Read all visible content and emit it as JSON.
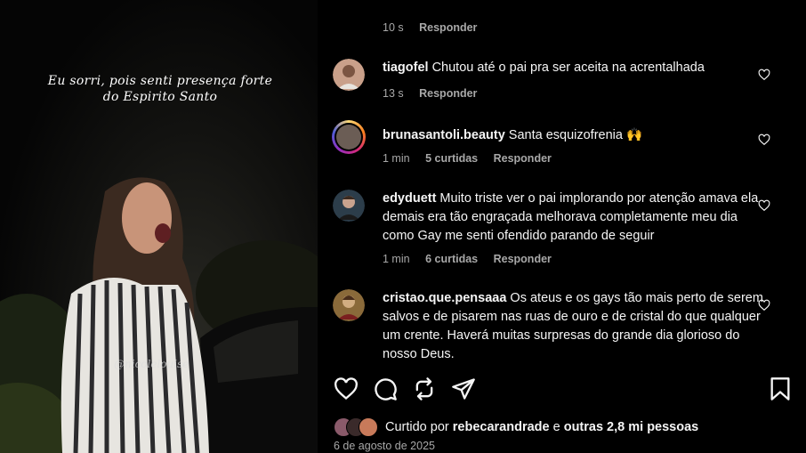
{
  "media": {
    "caption_line1": "Eu sorri, pois senti presença forte",
    "caption_line2": "do Espirito Santo",
    "watermark": "@nicolelouise"
  },
  "top_comment_meta": {
    "time": "10 s",
    "reply": "Responder"
  },
  "comments": [
    {
      "username": "tiagofel",
      "text": "Chutou até o pai pra ser aceita na acrentalhada",
      "time": "13 s",
      "likes": "",
      "reply": "Responder"
    },
    {
      "username": "brunasantoli.beauty",
      "text": "Santa esquizofrenia 🙌",
      "time": "1 min",
      "likes": "5 curtidas",
      "reply": "Responder"
    },
    {
      "username": "edyduett",
      "text": "Muito triste ver o pai implorando por atenção amava ela demais era tão engraçada melhorava completamente meu dia como Gay me senti ofendido parando de seguir",
      "time": "1 min",
      "likes": "6 curtidas",
      "reply": "Responder"
    },
    {
      "username": "cristao.que.pensaaa",
      "text": "Os ateus e os gays tão mais perto de serem salvos e de pisarem nas ruas de ouro e de cristal do que qualquer um crente. Haverá muitas surpresas do grande dia glorioso do nosso Deus.",
      "time": "",
      "likes": "",
      "reply": ""
    }
  ],
  "actions": {
    "icons": [
      "heart-icon",
      "comment-icon",
      "repost-icon",
      "share-icon",
      "bookmark-icon"
    ]
  },
  "likes_summary": {
    "prefix": "Curtido por",
    "user": "rebecarandrade",
    "connector": "e",
    "others": "outras 2,8 mi pessoas"
  },
  "post_date": "6 de agosto de 2025"
}
